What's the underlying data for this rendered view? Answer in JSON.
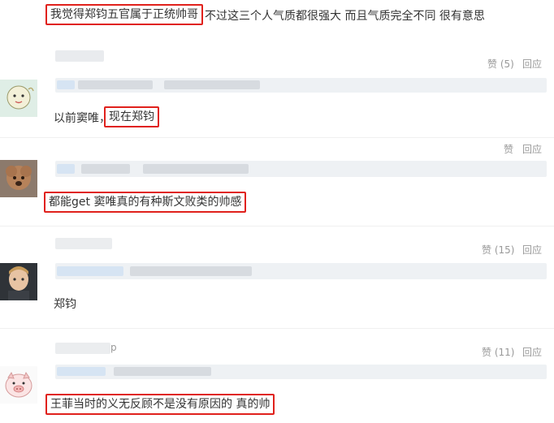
{
  "top_comment": {
    "boxed": "我觉得郑钧五官属于正统帅哥",
    "rest": "不过这三个人气质都很强大 而且气质完全不同 很有意思"
  },
  "comments": [
    {
      "likes": "赞 (5)",
      "reply": "回应",
      "text_plain": "以前窦唯，",
      "text_boxed": "现在郑钧"
    },
    {
      "likes": "赞",
      "reply": "回应",
      "text_boxed": "都能get 窦唯真的有种斯文败类的帅感"
    },
    {
      "likes": "赞 (15)",
      "reply": "回应",
      "text_plain": "郑钧"
    },
    {
      "username_fragment": "p",
      "likes": "赞 (11)",
      "reply": "回应",
      "text_boxed": "王菲当时的义无反顾不是没有原因的 真的帅"
    }
  ],
  "colors": {
    "highlight_border": "#e0211c",
    "meta_text": "#999999",
    "body_text": "#333333"
  }
}
